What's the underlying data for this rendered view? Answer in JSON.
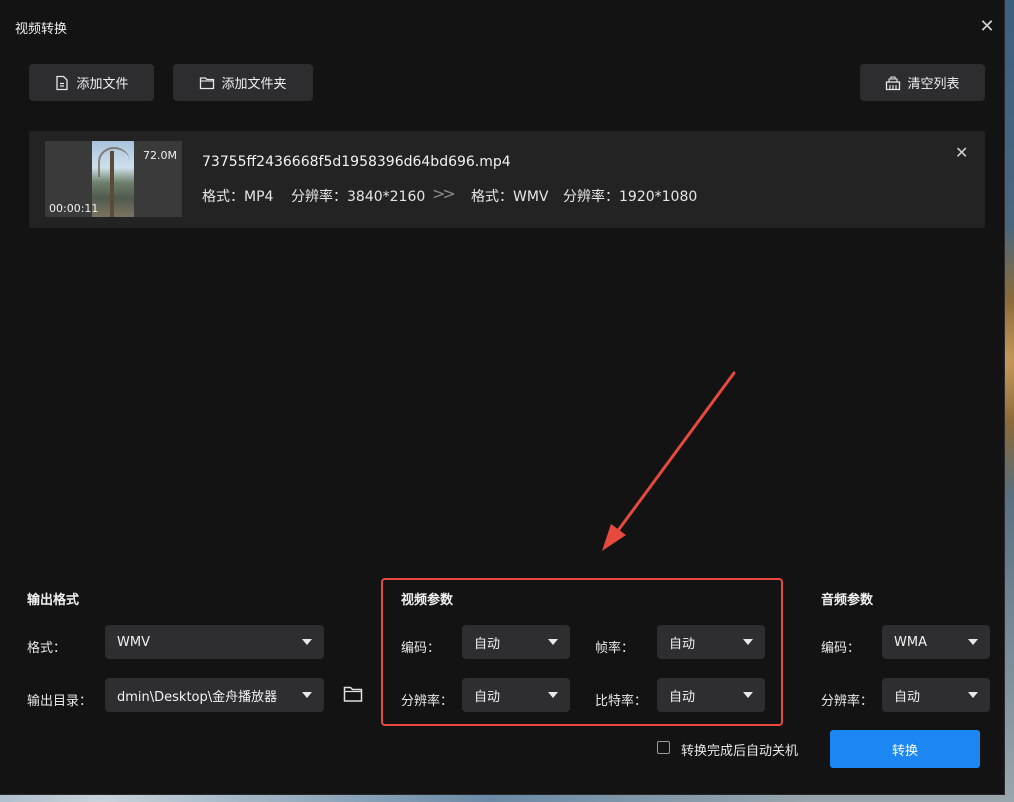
{
  "window": {
    "title": "视频转换"
  },
  "toolbar": {
    "add_file": "添加文件",
    "add_folder": "添加文件夹",
    "clear_list": "清空列表"
  },
  "file": {
    "name": "73755ff2436668f5d1958396d64bd696.mp4",
    "duration": "00:00:11",
    "size": "72.0M",
    "source_format": "格式：MP4",
    "source_resolution": "分辨率：3840*2160",
    "target_format": "格式：WMV",
    "target_resolution": "分辨率：1920*1080"
  },
  "output": {
    "header": "输出格式",
    "format_label": "格式：",
    "format_value": "WMV",
    "dir_label": "输出目录：",
    "dir_value": "dmin\\Desktop\\金舟播放器"
  },
  "video": {
    "header": "视频参数",
    "codec_label": "编码：",
    "codec_value": "自动",
    "framerate_label": "帧率：",
    "framerate_value": "自动",
    "resolution_label": "分辨率：",
    "resolution_value": "自动",
    "bitrate_label": "比特率：",
    "bitrate_value": "自动"
  },
  "audio": {
    "header": "音频参数",
    "codec_label": "编码：",
    "codec_value": "WMA",
    "resolution_label": "分辨率：",
    "resolution_value": "自动"
  },
  "footer": {
    "shutdown_label": "转换完成后自动关机",
    "shutdown_checked": false,
    "convert_button": "转换"
  },
  "colors": {
    "accent": "#1c86f2",
    "highlight": "#e64a3e",
    "window_bg": "#131314"
  }
}
